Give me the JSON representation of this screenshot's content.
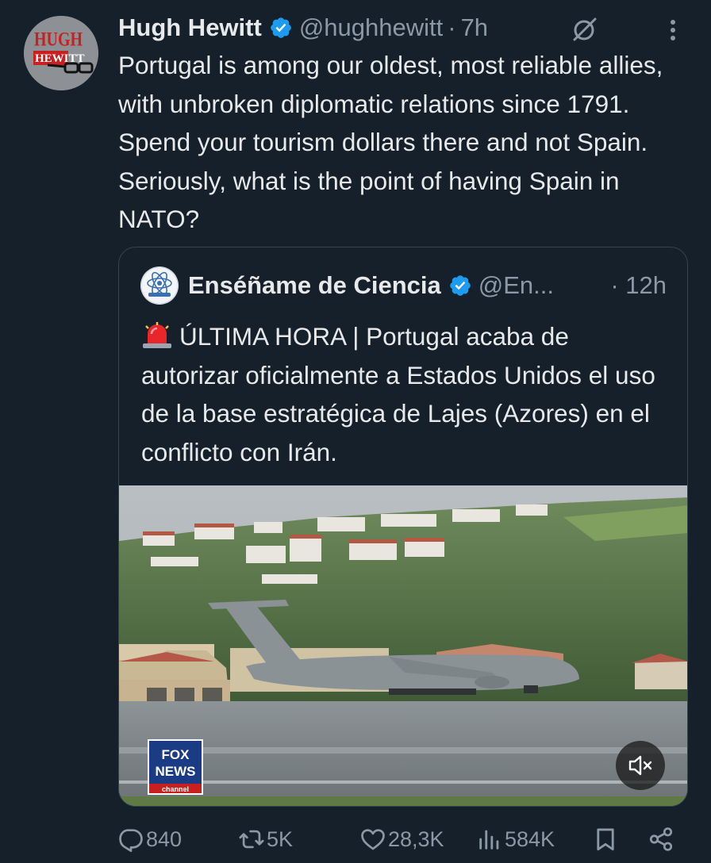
{
  "tweet": {
    "author_name": "Hugh Hewitt",
    "handle": "@hughhewitt",
    "separator": "·",
    "time": "7h",
    "avatar_logo": "HUGH HEWITT",
    "text": "Portugal is among our oldest, most reliable allies, with unbroken diplomatic relations since 1791. Spend your tourism dollars there and not Spain. Seriously, what is the point of having Spain in NATO?"
  },
  "quote": {
    "author_name": "Enséñame de Ciencia",
    "handle": "@En...",
    "time": "· 12h",
    "avatar_logo": "Enséñame de Ciencia",
    "text": "ÚLTIMA HORA | Portugal acaba de autorizar oficialmente a Estados Unidos el uso de la base estratégica de Lajes (Azores) en el conflicto con Irán.",
    "media": {
      "type": "video",
      "logo_text": [
        "FOX",
        "NEWS",
        "channel"
      ],
      "muted": true
    }
  },
  "actions": {
    "replies": "840",
    "reposts": "5K",
    "likes": "28,3K",
    "views": "584K"
  },
  "icons": {
    "verified": "verified-badge-icon",
    "grok": "grok-icon",
    "more": "more-options-icon",
    "siren": "siren-emoji-icon",
    "reply": "reply-icon",
    "repost": "repost-icon",
    "like": "heart-icon",
    "views": "views-icon",
    "bookmark": "bookmark-icon",
    "share": "share-icon",
    "mute": "mute-icon"
  },
  "colors": {
    "background": "#15202b",
    "text": "#e7e9ea",
    "secondary": "#8b98a5",
    "verified": "#1d9bf0",
    "border": "#38444d"
  }
}
